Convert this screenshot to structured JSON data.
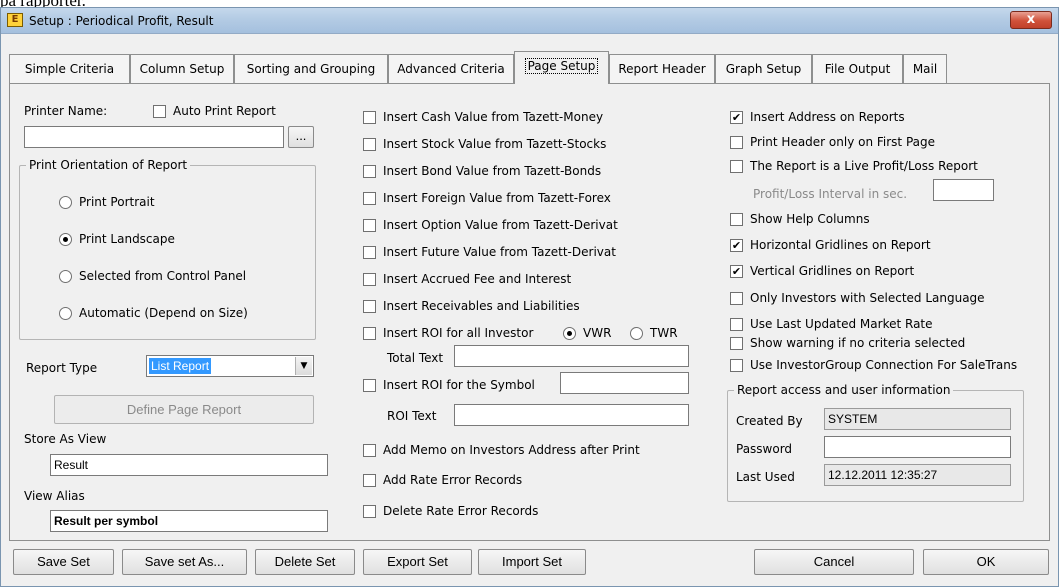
{
  "background_text": "på rapporter.",
  "window": {
    "title": "Setup : Periodical Profit, Result",
    "icon_label": "E",
    "close_label": "x"
  },
  "tabs": [
    {
      "label": "Simple Criteria",
      "active": false
    },
    {
      "label": "Column Setup",
      "active": false
    },
    {
      "label": "Sorting and Grouping",
      "active": false
    },
    {
      "label": "Advanced Criteria",
      "active": false
    },
    {
      "label": "Page Setup",
      "active": true
    },
    {
      "label": "Report Header",
      "active": false
    },
    {
      "label": "Graph Setup",
      "active": false
    },
    {
      "label": "File Output",
      "active": false
    },
    {
      "label": "Mail",
      "active": false
    }
  ],
  "left": {
    "printer_name_label": "Printer Name:",
    "auto_print_label": "Auto Print Report",
    "auto_print_checked": false,
    "printer_name_value": "",
    "browse_label": "...",
    "orientation_group_title": "Print Orientation of Report",
    "orientation_options": [
      {
        "label": "Print Portrait",
        "selected": false
      },
      {
        "label": "Print Landscape",
        "selected": true
      },
      {
        "label": "Selected from Control Panel",
        "selected": false
      },
      {
        "label": "Automatic (Depend on Size)",
        "selected": false
      }
    ],
    "report_type_label": "Report Type",
    "report_type_value": "List Report",
    "define_page_report_label": "Define Page Report",
    "store_as_view_label": "Store As View",
    "store_as_view_value": "Result",
    "view_alias_label": "View Alias",
    "view_alias_value": "Result per symbol"
  },
  "middle": {
    "checkboxes": [
      {
        "label": "Insert Cash Value from Tazett-Money",
        "checked": false
      },
      {
        "label": "Insert Stock Value from Tazett-Stocks",
        "checked": false
      },
      {
        "label": "Insert Bond Value from Tazett-Bonds",
        "checked": false
      },
      {
        "label": "Insert Foreign Value from Tazett-Forex",
        "checked": false
      },
      {
        "label": "Insert Option Value from Tazett-Derivat",
        "checked": false
      },
      {
        "label": "Insert Future Value from Tazett-Derivat",
        "checked": false
      },
      {
        "label": "Insert Accrued Fee and Interest",
        "checked": false
      },
      {
        "label": "Insert Receivables and Liabilities",
        "checked": false
      }
    ],
    "roi_all_label": "Insert ROI for all Investor",
    "roi_all_checked": false,
    "vwr_label": "VWR",
    "vwr_selected": true,
    "twr_label": "TWR",
    "twr_selected": false,
    "total_text_label": "Total Text",
    "total_text_value": "",
    "roi_symbol_label": "Insert ROI for the Symbol",
    "roi_symbol_checked": false,
    "roi_symbol_value": "",
    "roi_text_label": "ROI Text",
    "roi_text_value": "",
    "memo_label": "Add Memo on Investors Address after Print",
    "memo_checked": false,
    "add_rate_error_label": "Add Rate Error Records",
    "add_rate_error_checked": false,
    "delete_rate_error_label": "Delete Rate Error Records",
    "delete_rate_error_checked": false
  },
  "right": {
    "checkboxes_top": [
      {
        "label": "Insert Address on Reports",
        "checked": true
      },
      {
        "label": "Print Header only on First Page",
        "checked": false
      },
      {
        "label": "The Report is a Live Profit/Loss Report",
        "checked": false
      }
    ],
    "interval_label": "Profit/Loss Interval in sec.",
    "interval_value": "",
    "checkboxes_bottom": [
      {
        "label": "Show Help Columns",
        "checked": false
      },
      {
        "label": "Horizontal Gridlines on Report",
        "checked": true
      },
      {
        "label": "Vertical Gridlines on Report",
        "checked": true
      },
      {
        "label": "Only Investors with Selected Language",
        "checked": false
      },
      {
        "label": "Use Last Updated Market Rate",
        "checked": false
      },
      {
        "label": "Show warning if no criteria selected",
        "checked": false
      },
      {
        "label": "Use InvestorGroup Connection For SaleTrans",
        "checked": false
      }
    ],
    "access_group_title": "Report access and user information",
    "created_by_label": "Created By",
    "created_by_value": "SYSTEM",
    "password_label": "Password",
    "password_value": "",
    "last_used_label": "Last Used",
    "last_used_value": "12.12.2011 12:35:27"
  },
  "footer": {
    "save_set": "Save Set",
    "save_set_as": "Save set As...",
    "delete_set": "Delete Set",
    "export_set": "Export Set",
    "import_set": "Import Set",
    "cancel": "Cancel",
    "ok": "OK"
  }
}
